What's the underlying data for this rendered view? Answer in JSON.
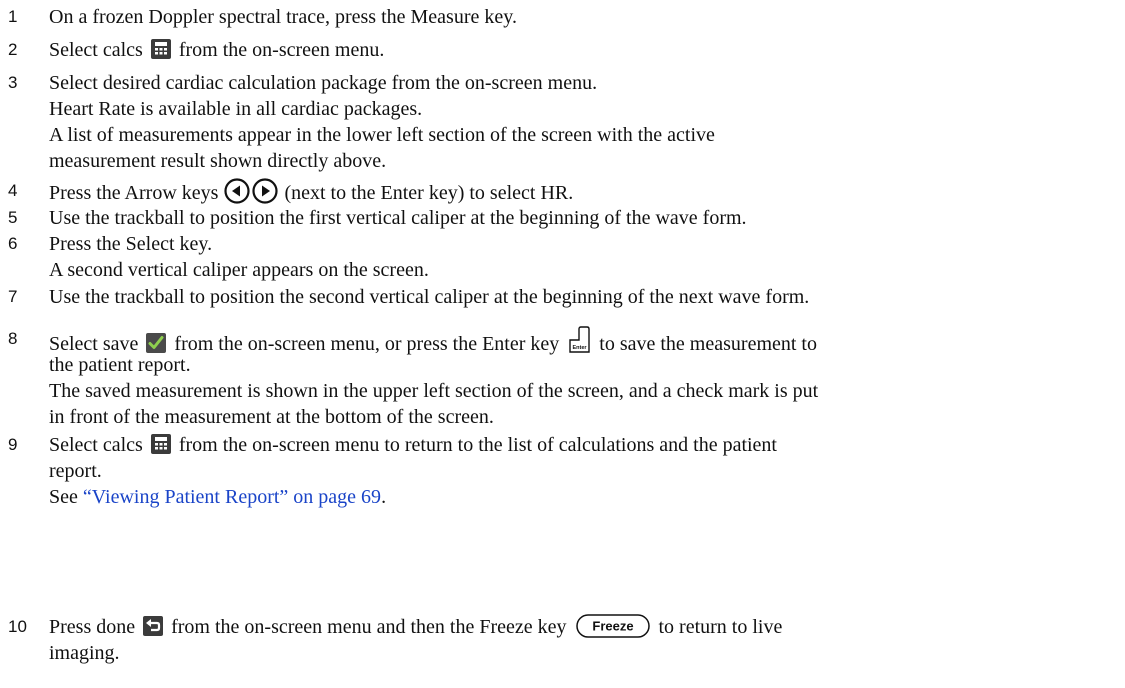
{
  "steps": [
    {
      "num": "1",
      "lines": [
        {
          "text": "On a frozen Doppler spectral trace, press the Measure key."
        }
      ]
    },
    {
      "num": "2",
      "lines": [
        {
          "before": "Select calcs",
          "after": "from the on-screen menu."
        }
      ]
    },
    {
      "num": "3",
      "lines": [
        {
          "text": "Select desired cardiac calculation package from the on-screen menu."
        },
        {
          "text": "Heart Rate is available in all cardiac packages."
        },
        {
          "text": "A list of measurements appear in the lower left section of the screen with the active"
        },
        {
          "text": "measurement result shown directly above."
        }
      ]
    },
    {
      "num": "4",
      "lines": [
        {
          "before": "Press the Arrow keys",
          "after": "(next to the Enter key) to select HR."
        }
      ]
    },
    {
      "num": "5",
      "lines": [
        {
          "text": "Use the trackball to position the first vertical caliper at the beginning of the wave form."
        }
      ]
    },
    {
      "num": "6",
      "lines": [
        {
          "text": "Press the Select key."
        },
        {
          "text": "A second vertical caliper appears on the screen."
        }
      ]
    },
    {
      "num": "7",
      "lines": [
        {
          "text": "Use the trackball to position the second vertical caliper at the beginning of the next wave form."
        }
      ]
    },
    {
      "num": "8",
      "lines": [
        {
          "before": "Select save",
          "middle": "from the on-screen menu, or press the Enter key",
          "after": "to save the measurement to"
        },
        {
          "text": "the patient report."
        },
        {
          "text": "The saved measurement is shown in the upper left section of the screen, and a check mark is put"
        },
        {
          "text": "in front of the measurement at the bottom of the screen."
        }
      ]
    },
    {
      "num": "9",
      "lines": [
        {
          "before": "Select calcs",
          "after": "from the on-screen menu to return to the list of calculations and the patient"
        },
        {
          "text": "report."
        },
        {
          "before": "See",
          "link": "“Viewing Patient Report” on page 69",
          "after": "."
        }
      ]
    },
    {
      "num": "10",
      "lines": [
        {
          "before": "Press done",
          "middle": "from the on-screen menu and then the Freeze key",
          "after": "to return to live"
        },
        {
          "text": "imaging."
        }
      ]
    }
  ],
  "icons": {
    "calcs": "calculator-icon",
    "arrows": [
      "arrow-left-key-icon",
      "arrow-right-key-icon"
    ],
    "save": "checkmark-save-icon",
    "enter": "enter-key-icon",
    "done": "done-return-icon",
    "freeze": "freeze-key-icon",
    "enter_key_label": "Enter",
    "freeze_key_label": "Freeze"
  },
  "colors": {
    "text": "#111111",
    "link": "#1a44c8",
    "icon_dark": "#3b3b3b",
    "save_green": "#4a8a2c"
  }
}
